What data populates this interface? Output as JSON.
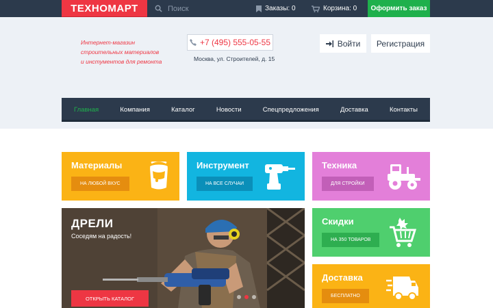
{
  "topbar": {
    "logo": "ТЕХНОМАРТ",
    "search_placeholder": "Поиск",
    "orders": "Заказы: 0",
    "cart": "Корзина: 0",
    "checkout": "Оформить заказ"
  },
  "header": {
    "slogan": [
      "Интернет-магазин",
      "строительных материалов",
      "и инстументов для ремонта"
    ],
    "phone": "+7 (495) 555-05-55",
    "address": "Москва, ул. Строителей, д. 15",
    "login": "Войти",
    "register": "Регистрация"
  },
  "nav": {
    "items": [
      "Главная",
      "Компания",
      "Каталог",
      "Новости",
      "Спецпредложения",
      "Доставка",
      "Контакты"
    ],
    "active_index": 0
  },
  "tiles": {
    "materials": {
      "title": "Материалы",
      "button": "НА ЛЮБОЙ ВКУС"
    },
    "tools": {
      "title": "Инструмент",
      "button": "НА ВСЕ СЛУЧАИ"
    },
    "tech": {
      "title": "Техника",
      "button": "ДЛЯ СТРОЙКИ"
    },
    "sale": {
      "title": "Скидки",
      "button": "НА 350 ТОВАРОВ"
    },
    "delivery": {
      "title": "Доставка",
      "button": "БЕСПЛАТНО"
    }
  },
  "hero": {
    "title": "ДРЕЛИ",
    "subtitle": "Соседям на радость!",
    "button": "ОТКРЫТЬ КАТАЛОГ",
    "slides_total": 3,
    "active_slide": 1
  },
  "colors": {
    "brand_red": "#ee3643",
    "dark_blue": "#2c3a4c",
    "green": "#1fb04c",
    "yellow": "#fbb315",
    "cyan": "#12b5e0",
    "pink": "#e37fd9",
    "light_green": "#4fcf6e"
  },
  "icons": [
    "search-icon",
    "bookmark-icon",
    "cart-icon",
    "phone-icon",
    "login-icon",
    "paint-bucket-icon",
    "drill-icon",
    "tractor-icon",
    "sale-cart-icon",
    "truck-icon"
  ]
}
